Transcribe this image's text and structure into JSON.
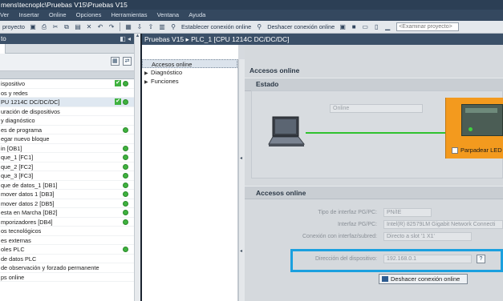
{
  "window": {
    "title": "mens\\tecnoplc\\Pruebas V15\\Pruebas V15"
  },
  "menu": [
    "Ver",
    "Insertar",
    "Online",
    "Opciones",
    "Herramientas",
    "Ventana",
    "Ayuda"
  ],
  "toolbar": {
    "project_label": "proyecto",
    "connect_label": "Establecer conexión online",
    "disconnect_label": "Deshacer conexión online",
    "search_placeholder": "<Examinar proyecto>"
  },
  "left_panel": {
    "title": "to",
    "tree": [
      {
        "label": "ispositivo",
        "check": true,
        "online": true
      },
      {
        "label": "os y redes",
        "check": false,
        "online": false
      },
      {
        "label": "PU 1214C DC/DC/DC]",
        "check": true,
        "online": true,
        "selected": true
      },
      {
        "label": "uración de dispositivos",
        "check": false,
        "online": false
      },
      {
        "label": "y diagnóstico",
        "check": false,
        "online": false
      },
      {
        "label": "es de programa",
        "check": false,
        "online": true
      },
      {
        "label": "egar nuevo bloque",
        "check": false,
        "online": false
      },
      {
        "label": "in [OB1]",
        "check": false,
        "online": true
      },
      {
        "label": "que_1 [FC1]",
        "check": false,
        "online": true
      },
      {
        "label": "que_2 [FC2]",
        "check": false,
        "online": true
      },
      {
        "label": "que_3 [FC3]",
        "check": false,
        "online": true
      },
      {
        "label": "que de datos_1 [DB1]",
        "check": false,
        "online": true
      },
      {
        "label": "mover datos 1 [DB3]",
        "check": false,
        "online": true
      },
      {
        "label": "mover datos 2 [DB5]",
        "check": false,
        "online": true
      },
      {
        "label": "esta en Marcha [DB2]",
        "check": false,
        "online": true
      },
      {
        "label": "mporizadores [DB4]",
        "check": false,
        "online": true
      },
      {
        "label": "os tecnológicos",
        "check": false,
        "online": false
      },
      {
        "label": "es externas",
        "check": false,
        "online": false
      },
      {
        "label": "oles PLC",
        "check": false,
        "online": true
      },
      {
        "label": "de datos PLC",
        "check": false,
        "online": false
      },
      {
        "label": "de observación y forzado permanente",
        "check": false,
        "online": false
      },
      {
        "label": "ps online",
        "check": false,
        "online": false
      }
    ]
  },
  "editor": {
    "breadcrumb": "Pruebas V15 ▸ PLC_1 [CPU 1214C DC/DC/DC]",
    "nav": [
      {
        "label": "Accesos online",
        "arrow": "",
        "selected": true
      },
      {
        "label": "Diagnóstico",
        "arrow": "▶",
        "selected": false
      },
      {
        "label": "Funciones",
        "arrow": "▶",
        "selected": false
      }
    ],
    "heading": "Accesos online",
    "status_section": "Estado",
    "online_text": "Online",
    "blink_led_label": "Parpadear LED",
    "access_section": "Accesos online",
    "fields": {
      "iface_type_label": "Tipo de interfaz PG/PC:",
      "iface_type_value": "PN/IE",
      "iface_label": "Interfaz PG/PC:",
      "iface_value": "Intel(R) 82579LM Gigabit Network Connecti",
      "subnet_label": "Conexión con interfaz/subred:",
      "subnet_value": "Directo a slot '1 X1'",
      "address_label": "Dirección del dispositivo:",
      "address_value": "192.168.0.1"
    },
    "disconnect_button": "Deshacer conexión online"
  },
  "colors": {
    "header": "#3b5068",
    "highlight": "#1ba0df",
    "plc_panel": "#f39a1e",
    "online_green": "#2fc22f"
  }
}
